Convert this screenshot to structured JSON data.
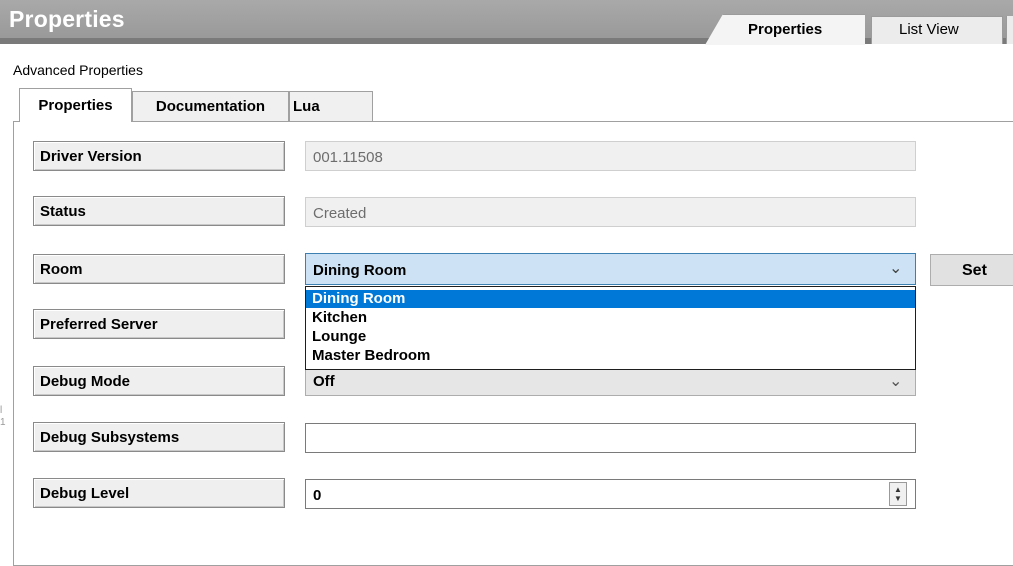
{
  "header": {
    "title": "Properties",
    "tabs": [
      {
        "label": "Properties",
        "active": true
      },
      {
        "label": "List View",
        "active": false
      }
    ]
  },
  "section_title": "Advanced Properties",
  "inner_tabs": [
    {
      "label": "Properties",
      "active": true
    },
    {
      "label": "Documentation",
      "active": false
    },
    {
      "label": "Lua",
      "active": false
    }
  ],
  "properties": {
    "driver_version": {
      "label": "Driver Version",
      "value": "001.11508"
    },
    "status": {
      "label": "Status",
      "value": "Created"
    },
    "room": {
      "label": "Room",
      "value": "Dining Room",
      "options": [
        "Dining Room",
        "Kitchen",
        "Lounge",
        "Master Bedroom"
      ],
      "set_label": "Set"
    },
    "preferred_server": {
      "label": "Preferred Server"
    },
    "debug_mode": {
      "label": "Debug Mode",
      "value": "Off"
    },
    "debug_subsystems": {
      "label": "Debug Subsystems",
      "value": ""
    },
    "debug_level": {
      "label": "Debug Level",
      "value": "0"
    }
  },
  "side_marks": [
    "l",
    "1"
  ],
  "colors": {
    "header_bg": "#9a9a9a",
    "selection": "#0078d7",
    "combo_focus": "#cde3f5"
  },
  "icons": {
    "chevron": "chevron-down-icon",
    "spinner": "spin-arrows-icon"
  }
}
